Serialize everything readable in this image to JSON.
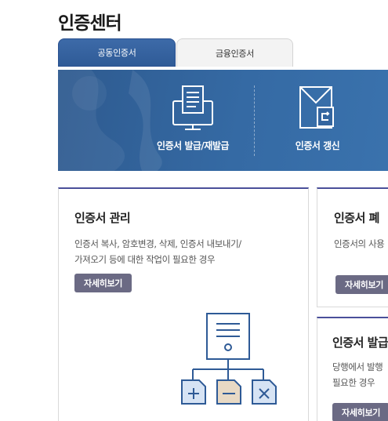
{
  "page": {
    "title": "인증센터"
  },
  "tabs": [
    {
      "label": "공동인증서",
      "active": true
    },
    {
      "label": "금융인증서",
      "active": false
    }
  ],
  "banner": {
    "items": [
      {
        "label": "인증서 발급/재발급",
        "icon": "monitor-document-icon"
      },
      {
        "label": "인증서 갱신",
        "icon": "envelope-refresh-icon"
      }
    ]
  },
  "cards": [
    {
      "title": "인증서 관리",
      "desc_lines": [
        "인증서 복사, 암호변경, 삭제, 인증서 내보내기/",
        "가져오기 등에 대한 작업이 필요한 경우"
      ],
      "button": "자세히보기"
    },
    {
      "title": "인증서 폐",
      "desc_lines": [
        "인증서의 사용"
      ],
      "button": "자세히보기"
    },
    {
      "title": "인증서 발급",
      "desc_lines": [
        "당행에서 발행",
        "필요한 경우"
      ],
      "button": "자세히보기"
    }
  ],
  "colors": {
    "banner": "#356aa4",
    "tab_active": "#3d6aa8",
    "card_border_top": "#4a4f9a",
    "button": "#6b6a84",
    "illus_stroke": "#2e5a96",
    "illus_fill": "#d6e3f4",
    "illus_minus_fill": "#e8d9c4"
  }
}
